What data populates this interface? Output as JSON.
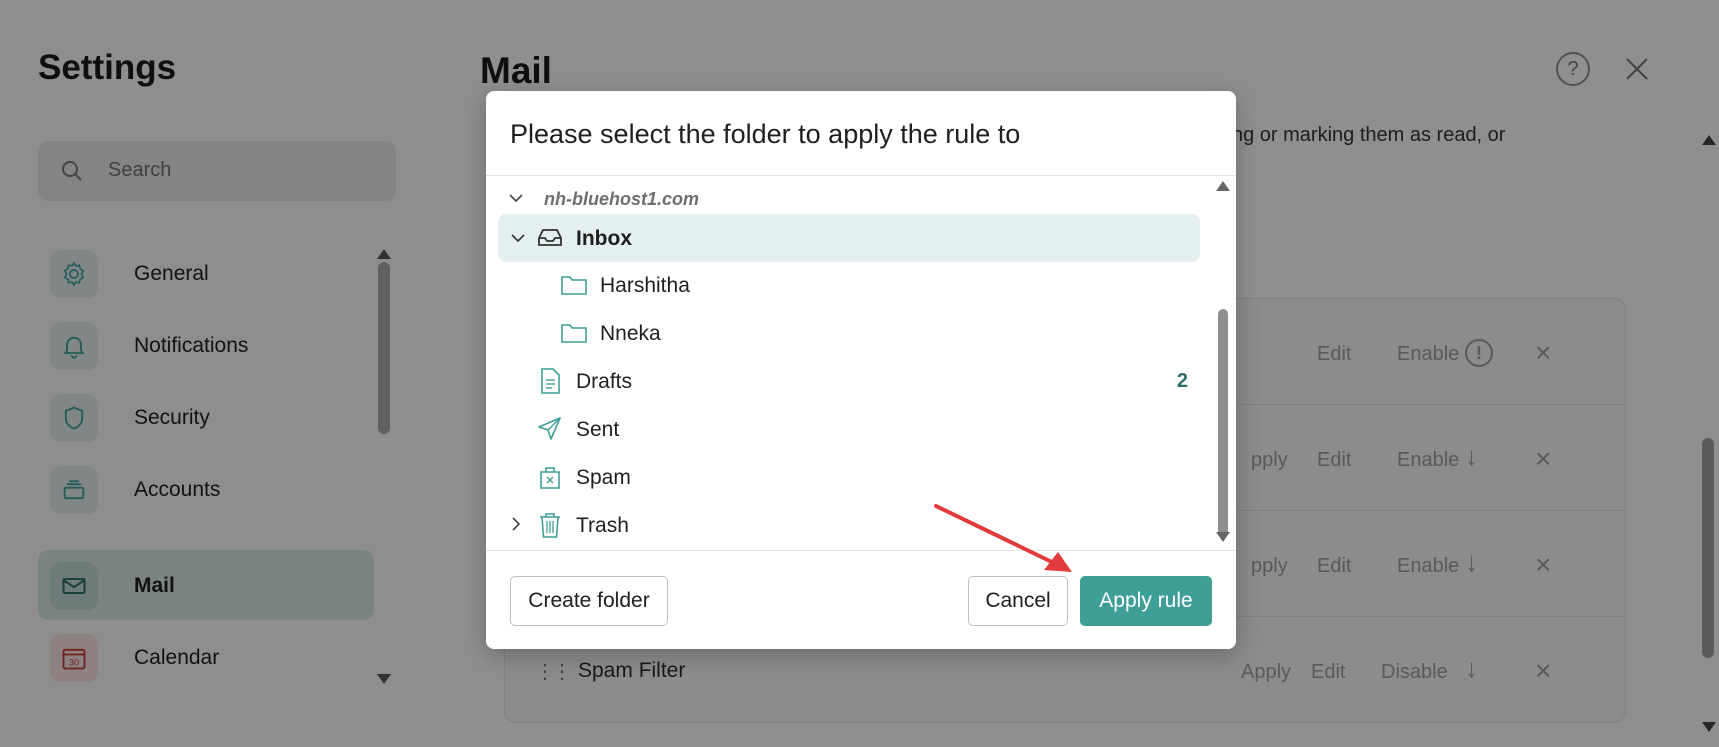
{
  "colors": {
    "accent": "#3f9f97",
    "accent_dark": "#2f6e68",
    "selected_row_bg": "#e3f0ef",
    "annotation_arrow": "#e23a3a"
  },
  "settings": {
    "title": "Settings",
    "search_placeholder": "Search",
    "nav": [
      {
        "label": "General",
        "icon": "gear-icon"
      },
      {
        "label": "Notifications",
        "icon": "bell-icon"
      },
      {
        "label": "Security",
        "icon": "shield-icon"
      },
      {
        "label": "Accounts",
        "icon": "accounts-icon"
      },
      {
        "label": "Mail",
        "icon": "envelope-icon",
        "active": true
      },
      {
        "label": "Calendar",
        "icon": "calendar-icon",
        "calendar_day": "30"
      }
    ]
  },
  "main": {
    "title": "Mail",
    "description_fragment": "ng or marking them as read, or",
    "rules": [
      {
        "name": "",
        "actions": [
          "Edit",
          "Enable"
        ]
      },
      {
        "name": "",
        "actions": [
          "pply",
          "Edit",
          "Enable"
        ]
      },
      {
        "name": "",
        "actions": [
          "pply",
          "Edit",
          "Enable"
        ]
      },
      {
        "name": "Spam Filter",
        "actions": [
          "Apply",
          "Edit",
          "Disable"
        ]
      }
    ]
  },
  "dialog": {
    "title": "Please select the folder to apply the rule to",
    "account": "nh-bluehost1.com",
    "folders": {
      "inbox": {
        "label": "Inbox"
      },
      "harshitha": {
        "label": "Harshitha"
      },
      "nneka": {
        "label": "Nneka"
      },
      "drafts": {
        "label": "Drafts",
        "count": "2"
      },
      "sent": {
        "label": "Sent"
      },
      "spam": {
        "label": "Spam"
      },
      "trash": {
        "label": "Trash"
      }
    },
    "buttons": {
      "create_folder": "Create folder",
      "cancel": "Cancel",
      "apply_rule": "Apply rule"
    }
  }
}
